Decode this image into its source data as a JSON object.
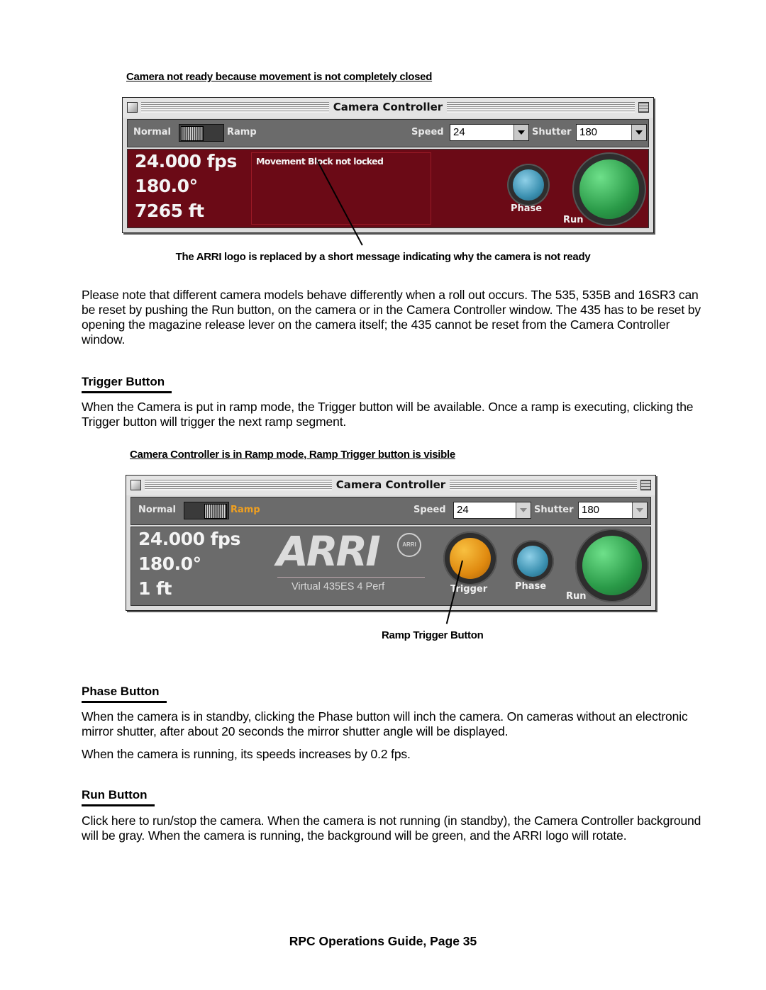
{
  "figure1": {
    "caption": "Camera not ready because movement is not completely closed",
    "window": {
      "title": "Camera Controller",
      "mode_left": "Normal",
      "mode_right": "Ramp",
      "mode_selected": "Normal",
      "speed_label": "Speed",
      "speed_value": "24",
      "shutter_label": "Shutter",
      "shutter_value": "180",
      "readout_fps": "24.000 fps",
      "readout_angle": "180.0°",
      "readout_footage": "7265 ft",
      "message": "Movement Block not locked",
      "phase_label": "Phase",
      "run_label": "Run",
      "background_color": "#6b0a16"
    },
    "annotation": "The ARRI logo is replaced by a short message indicating why the camera is not ready"
  },
  "intro_paragraph": "Please note that different camera models behave differently when a roll out occurs. The 535, 535B and 16SR3 can be reset by pushing the Run button, on the camera or in the Camera Controller window. The 435 has to be reset by opening the magazine release lever on the camera itself; the 435 cannot be reset from the Camera Controller window.",
  "trigger_section": {
    "heading": "Trigger Button",
    "body": "When the Camera is put in ramp mode, the Trigger button will be available. Once a ramp is executing, clicking the Trigger button will trigger the next ramp segment."
  },
  "figure2": {
    "caption": "Camera Controller  is in Ramp mode, Ramp Trigger button is visible",
    "window": {
      "title": "Camera Controller",
      "mode_left": "Normal",
      "mode_right": "Ramp",
      "mode_selected": "Ramp",
      "speed_label": "Speed",
      "speed_value": "24",
      "shutter_label": "Shutter",
      "shutter_value": "180",
      "readout_fps": "24.000 fps",
      "readout_angle": "180.0°",
      "readout_footage": "1 ft",
      "logo_text": "ARRI",
      "logo_badge": "ARRI",
      "model_text": "Virtual 435ES 4 Perf",
      "trigger_label": "Trigger",
      "phase_label": "Phase",
      "run_label": "Run",
      "background_color": "#6b6b6b",
      "ramp_accent_color": "#f0a020"
    },
    "annotation": "Ramp Trigger Button"
  },
  "phase_section": {
    "heading": "Phase Button",
    "body1": "When the camera is in standby, clicking the Phase button will inch the camera. On cameras without an electronic mirror shutter, after about 20 seconds the mirror shutter angle will be displayed.",
    "body2": "When the camera is running, its speeds increases by 0.2 fps."
  },
  "run_section": {
    "heading": "Run Button",
    "body": "Click here to run/stop the camera. When the camera is not running (in standby), the Camera Controller background will be gray. When the camera is running, the background will be green, and the ARRI logo will rotate."
  },
  "footer": "RPC Operations Guide, Page 35"
}
